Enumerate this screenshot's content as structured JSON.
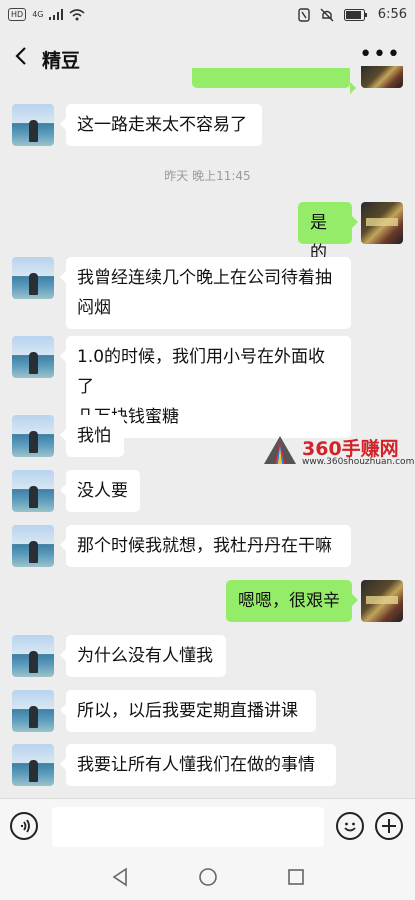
{
  "status": {
    "hd": "HD",
    "network": "4G",
    "time": "6:56"
  },
  "chat": {
    "title": "精豆"
  },
  "timestamp": "昨天 晚上11:45",
  "messages": [
    {
      "side": "left",
      "text": "这一路走来太不容易了"
    },
    {
      "side": "right",
      "text": "是的"
    },
    {
      "side": "left",
      "lines": [
        "我曾经连续几个晚上在公司待着抽",
        "闷烟"
      ]
    },
    {
      "side": "left",
      "lines": [
        "1.0的时候，我们用小号在外面收了",
        "几万块钱蜜糖"
      ]
    },
    {
      "side": "left",
      "text": "我怕"
    },
    {
      "side": "left",
      "text": "没人要"
    },
    {
      "side": "left",
      "text": "那个时候我就想，我杜丹丹在干嘛"
    },
    {
      "side": "right",
      "text": "嗯嗯，很艰辛"
    },
    {
      "side": "left",
      "text": "为什么没有人懂我"
    },
    {
      "side": "left",
      "text": "所以，以后我要定期直播讲课"
    },
    {
      "side": "left",
      "text": "我要让所有人懂我们在做的事情"
    }
  ],
  "watermark": {
    "brand": "360手赚网",
    "url": "www.360shouzhuan.com"
  },
  "colors": {
    "sent_bubble": "#95ec69",
    "received_bubble": "#ffffff",
    "background": "#ededed",
    "watermark_red": "#d2232a"
  }
}
